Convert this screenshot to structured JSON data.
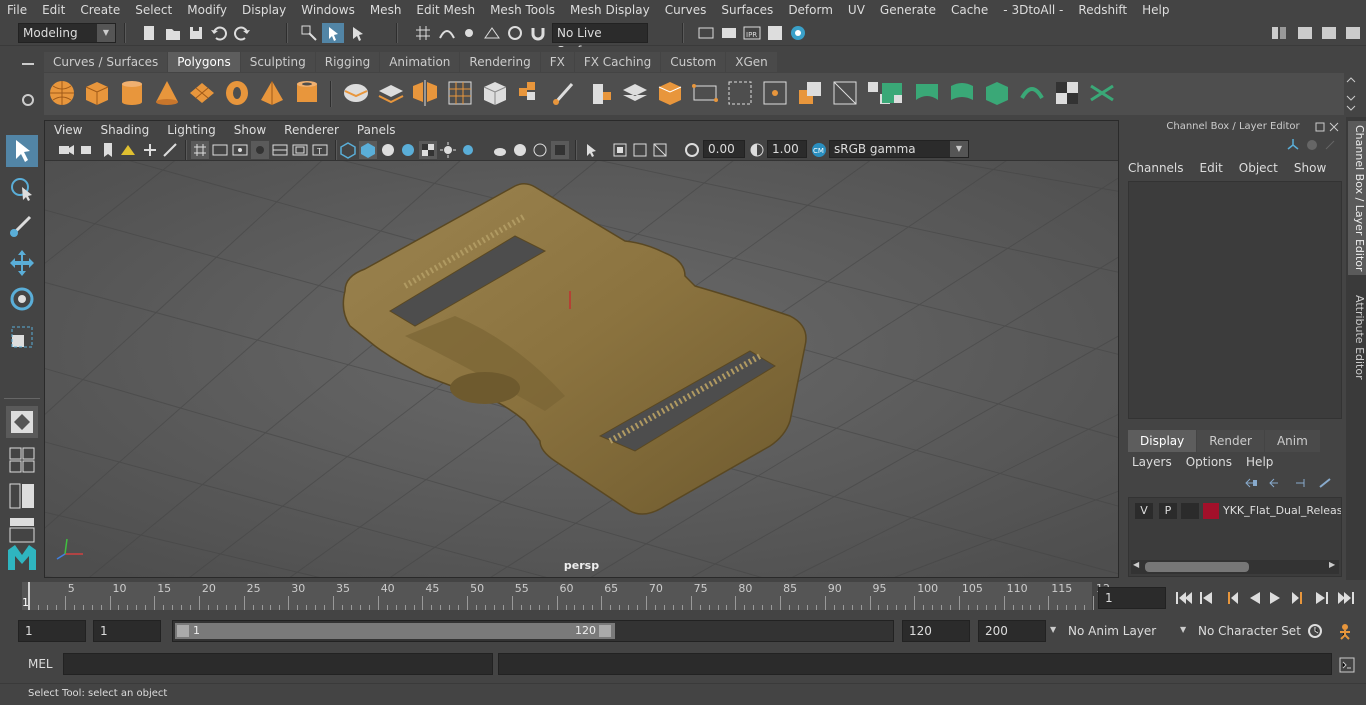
{
  "menubar": [
    "File",
    "Edit",
    "Create",
    "Select",
    "Modify",
    "Display",
    "Windows",
    "Mesh",
    "Edit Mesh",
    "Mesh Tools",
    "Mesh Display",
    "Curves",
    "Surfaces",
    "Deform",
    "UV",
    "Generate",
    "Cache",
    "- 3DtoAll -",
    "Redshift",
    "Help"
  ],
  "status": {
    "workspace": "Modeling",
    "live_surface": "No Live Surface"
  },
  "shelf_tabs": [
    "Curves / Surfaces",
    "Polygons",
    "Sculpting",
    "Rigging",
    "Animation",
    "Rendering",
    "FX",
    "FX Caching",
    "Custom",
    "XGen"
  ],
  "shelf_active": "Polygons",
  "viewport": {
    "menu": [
      "View",
      "Shading",
      "Lighting",
      "Show",
      "Renderer",
      "Panels"
    ],
    "exposure": "0.00",
    "gamma": "1.00",
    "color_space": "sRGB gamma",
    "camera_label": "persp"
  },
  "channel_box": {
    "title": "Channel Box / Layer Editor",
    "menu": [
      "Channels",
      "Edit",
      "Object",
      "Show"
    ]
  },
  "layer_editor": {
    "tabs": [
      "Display",
      "Render",
      "Anim"
    ],
    "active_tab": "Display",
    "menu": [
      "Layers",
      "Options",
      "Help"
    ],
    "layer": {
      "v": "V",
      "p": "P",
      "name": "YKK_Flat_Dual_Release",
      "color": "#a3102a"
    }
  },
  "side_tabs": [
    "Channel Box / Layer Editor",
    "Attribute Editor"
  ],
  "timeline": {
    "ticks": [
      "5",
      "10",
      "15",
      "20",
      "25",
      "30",
      "35",
      "40",
      "45",
      "50",
      "55",
      "60",
      "65",
      "70",
      "75",
      "80",
      "85",
      "90",
      "95",
      "100",
      "105",
      "110",
      "115",
      "12"
    ],
    "start_tick": "1",
    "current_frame": "1"
  },
  "range": {
    "start": "1",
    "playback_start": "1",
    "slider_start": "1",
    "slider_end": "120",
    "playback_end": "120",
    "end": "200",
    "anim_layer": "No Anim Layer",
    "character_set": "No Character Set"
  },
  "cmd": {
    "label": "MEL"
  },
  "help_line": "Select Tool: select an object"
}
